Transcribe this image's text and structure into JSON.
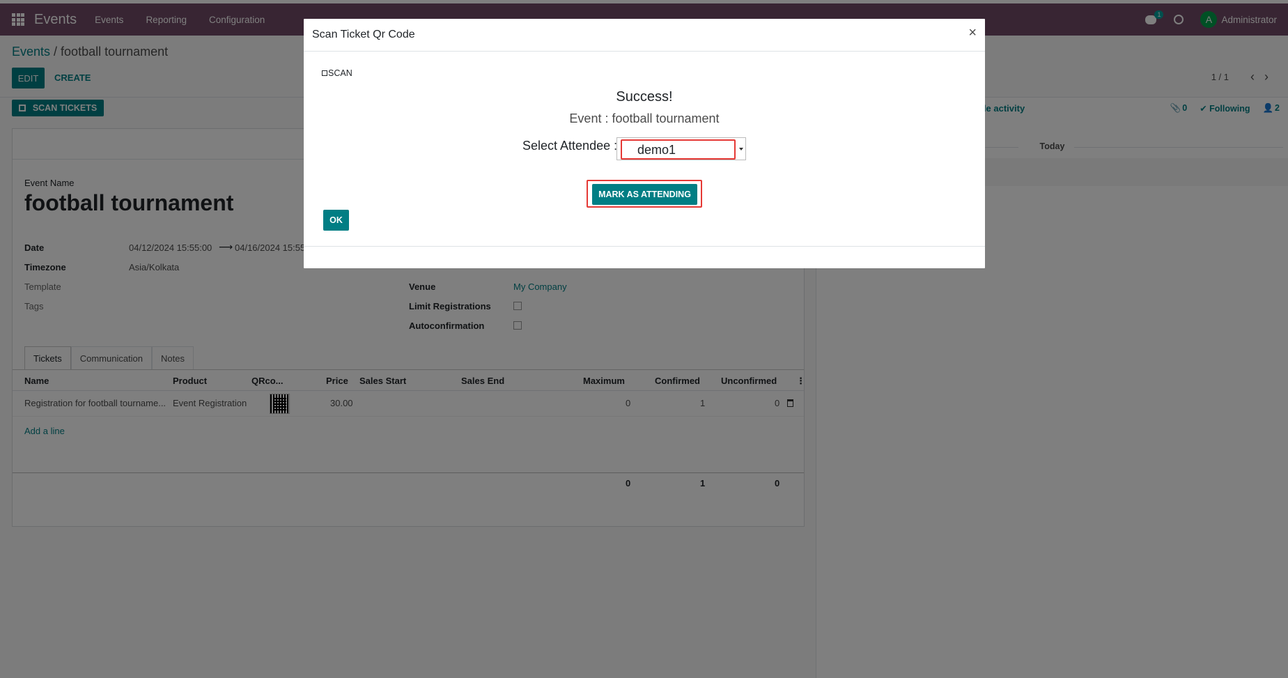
{
  "navbar": {
    "app_name": "Events",
    "menu": [
      "Events",
      "Reporting",
      "Configuration"
    ],
    "chat_badge": "1",
    "user_initial": "A",
    "user_name": "Administrator",
    "brand_color": "#714B67"
  },
  "control": {
    "breadcrumb_parent": "Events",
    "breadcrumb_sep": " / ",
    "breadcrumb_current": "football tournament",
    "edit_label": "EDIT",
    "create_label": "CREATE",
    "pager": "1 / 1",
    "prev_icon": "chevron-left-icon",
    "next_icon": "chevron-right-icon"
  },
  "statusbar": {
    "scan_tickets_label": "SCAN TICKETS"
  },
  "form": {
    "event_name_label": "Event Name",
    "event_name": "football tournament",
    "date_label": "Date",
    "date_start": "04/12/2024 15:55:00",
    "date_end": "04/16/2024 15:55",
    "timezone_label": "Timezone",
    "timezone": "Asia/Kolkata",
    "template_label": "Template",
    "tags_label": "Tags",
    "venue_label": "Venue",
    "venue": "My Company",
    "limit_label": "Limit Registrations",
    "autoconf_label": "Autoconfirmation",
    "tabs": [
      "Tickets",
      "Communication",
      "Notes"
    ],
    "columns": [
      "Name",
      "Product",
      "QRco...",
      "Price",
      "Sales Start",
      "Sales End",
      "Maximum",
      "Confirmed",
      "Unconfirmed"
    ],
    "row": {
      "name": "Registration for football tourname...",
      "product": "Event Registration",
      "price": "30.00",
      "maximum": "0",
      "confirmed": "1",
      "unconfirmed": "0"
    },
    "add_line": "Add a line",
    "totals": {
      "maximum": "0",
      "confirmed": "1",
      "unconfirmed": "0"
    }
  },
  "chatter": {
    "activity_label": "ule activity",
    "attachments": "0",
    "following_label": "Following",
    "followers": "2",
    "today_label": "Today"
  },
  "modal": {
    "title": "Scan Ticket Qr Code",
    "close_glyph": "×",
    "scan_label": "SCAN",
    "success": "Success!",
    "event_line": "Event : football tournament",
    "select_label": "Select Attendee :",
    "attendee": "demo1",
    "mark_label": "MARK AS ATTENDING",
    "ok_label": "OK",
    "accent_color": "#017e84",
    "highlight_color": "#e53935"
  }
}
